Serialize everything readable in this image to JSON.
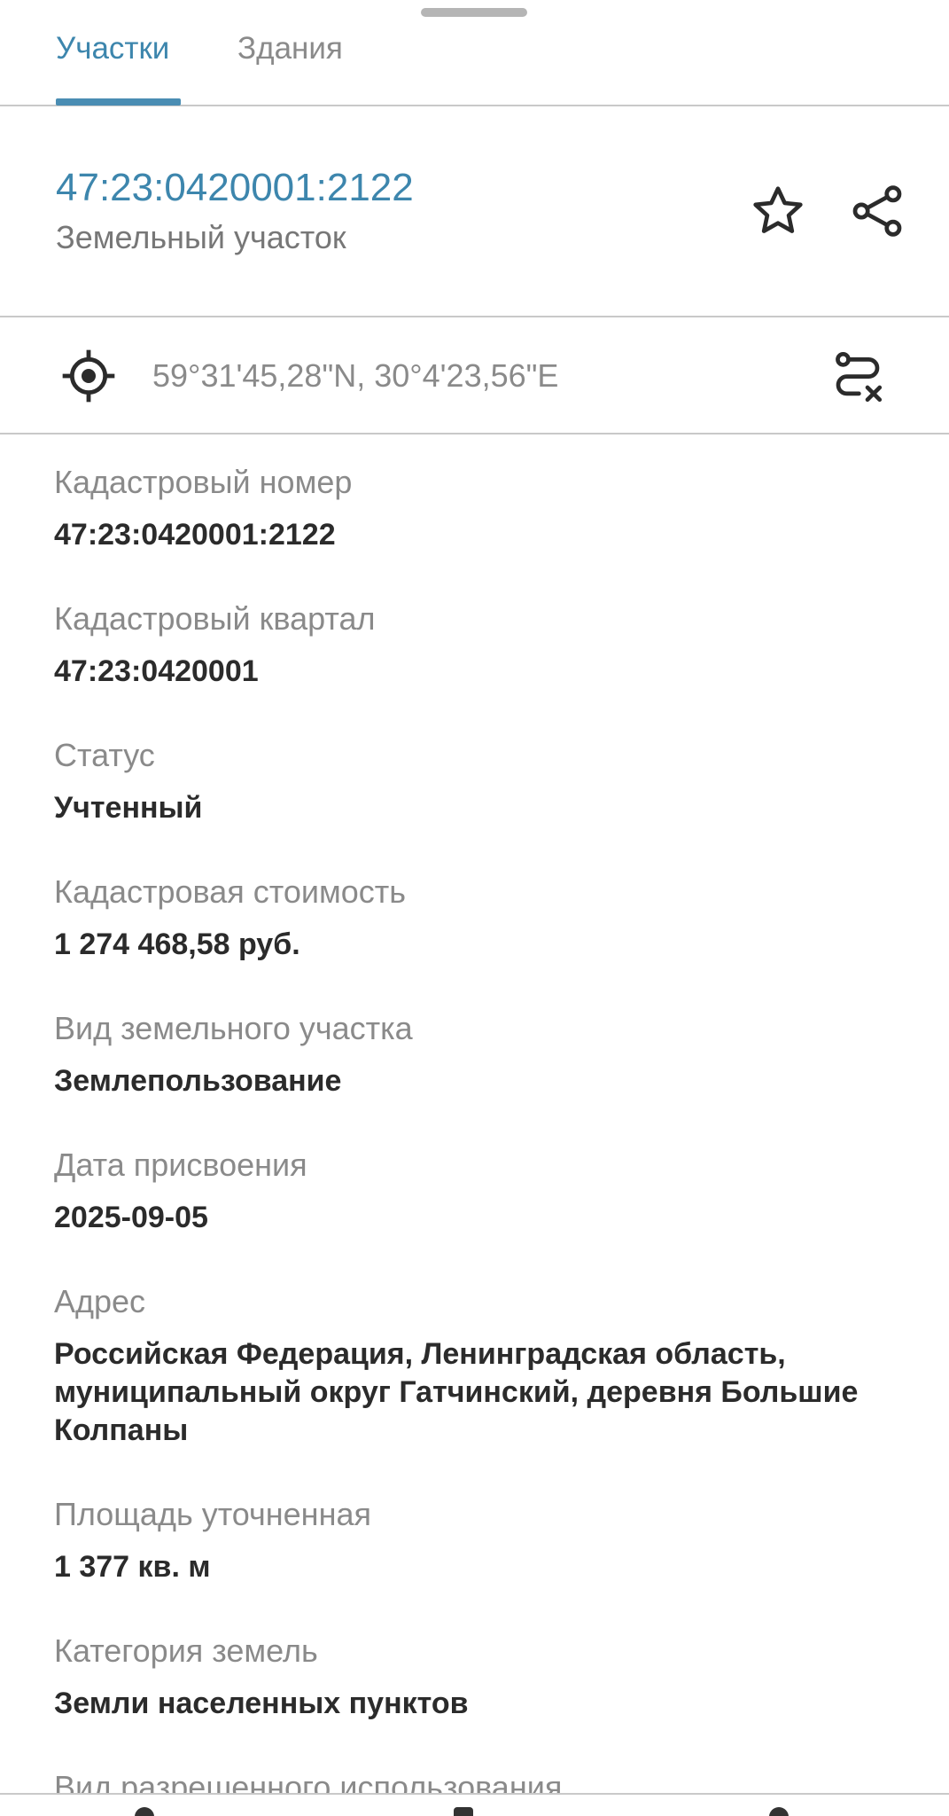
{
  "tabs": {
    "plots_label": "Участки",
    "buildings_label": "Здания"
  },
  "header": {
    "title": "47:23:0420001:2122",
    "subtitle": "Земельный участок",
    "favorite_icon": "star-icon",
    "share_icon": "share-icon"
  },
  "coords": {
    "text": "59°31'45,28\"N, 30°4'23,56\"E",
    "location_icon": "gps-target-icon",
    "route_icon": "route-clear-icon"
  },
  "fields": [
    {
      "label": "Кадастровый номер",
      "value": "47:23:0420001:2122"
    },
    {
      "label": "Кадастровый квартал",
      "value": "47:23:0420001"
    },
    {
      "label": "Статус",
      "value": "Учтенный"
    },
    {
      "label": "Кадастровая стоимость",
      "value": "1 274 468,58 руб."
    },
    {
      "label": "Вид земельного участка",
      "value": "Землепользование"
    },
    {
      "label": "Дата присвоения",
      "value": "2025-09-05"
    },
    {
      "label": "Адрес",
      "value": "Российская Федерация, Ленинградская область, муниципальный округ Гатчинский, деревня Большие Колпаны"
    },
    {
      "label": "Площадь уточненная",
      "value": "1 377 кв. м"
    },
    {
      "label": "Категория земель",
      "value": "Земли населенных пунктов"
    },
    {
      "label": "Вид разрешенного использования",
      "value": ""
    }
  ],
  "colors": {
    "accent": "#3d86ad",
    "label": "#8a8a8a",
    "value": "#2b2b2b",
    "divider": "#c9c9c9"
  }
}
